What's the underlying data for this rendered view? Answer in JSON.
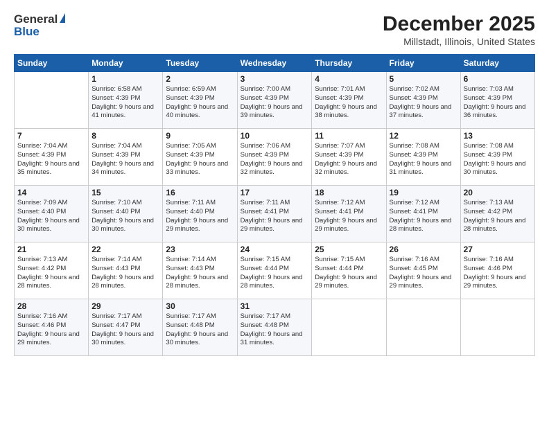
{
  "logo": {
    "line1": "General",
    "line2": "Blue"
  },
  "title": "December 2025",
  "subtitle": "Millstadt, Illinois, United States",
  "days_of_week": [
    "Sunday",
    "Monday",
    "Tuesday",
    "Wednesday",
    "Thursday",
    "Friday",
    "Saturday"
  ],
  "weeks": [
    [
      {
        "day": "",
        "sunrise": "",
        "sunset": "",
        "daylight": ""
      },
      {
        "day": "1",
        "sunrise": "Sunrise: 6:58 AM",
        "sunset": "Sunset: 4:39 PM",
        "daylight": "Daylight: 9 hours and 41 minutes."
      },
      {
        "day": "2",
        "sunrise": "Sunrise: 6:59 AM",
        "sunset": "Sunset: 4:39 PM",
        "daylight": "Daylight: 9 hours and 40 minutes."
      },
      {
        "day": "3",
        "sunrise": "Sunrise: 7:00 AM",
        "sunset": "Sunset: 4:39 PM",
        "daylight": "Daylight: 9 hours and 39 minutes."
      },
      {
        "day": "4",
        "sunrise": "Sunrise: 7:01 AM",
        "sunset": "Sunset: 4:39 PM",
        "daylight": "Daylight: 9 hours and 38 minutes."
      },
      {
        "day": "5",
        "sunrise": "Sunrise: 7:02 AM",
        "sunset": "Sunset: 4:39 PM",
        "daylight": "Daylight: 9 hours and 37 minutes."
      },
      {
        "day": "6",
        "sunrise": "Sunrise: 7:03 AM",
        "sunset": "Sunset: 4:39 PM",
        "daylight": "Daylight: 9 hours and 36 minutes."
      }
    ],
    [
      {
        "day": "7",
        "sunrise": "Sunrise: 7:04 AM",
        "sunset": "Sunset: 4:39 PM",
        "daylight": "Daylight: 9 hours and 35 minutes."
      },
      {
        "day": "8",
        "sunrise": "Sunrise: 7:04 AM",
        "sunset": "Sunset: 4:39 PM",
        "daylight": "Daylight: 9 hours and 34 minutes."
      },
      {
        "day": "9",
        "sunrise": "Sunrise: 7:05 AM",
        "sunset": "Sunset: 4:39 PM",
        "daylight": "Daylight: 9 hours and 33 minutes."
      },
      {
        "day": "10",
        "sunrise": "Sunrise: 7:06 AM",
        "sunset": "Sunset: 4:39 PM",
        "daylight": "Daylight: 9 hours and 32 minutes."
      },
      {
        "day": "11",
        "sunrise": "Sunrise: 7:07 AM",
        "sunset": "Sunset: 4:39 PM",
        "daylight": "Daylight: 9 hours and 32 minutes."
      },
      {
        "day": "12",
        "sunrise": "Sunrise: 7:08 AM",
        "sunset": "Sunset: 4:39 PM",
        "daylight": "Daylight: 9 hours and 31 minutes."
      },
      {
        "day": "13",
        "sunrise": "Sunrise: 7:08 AM",
        "sunset": "Sunset: 4:39 PM",
        "daylight": "Daylight: 9 hours and 30 minutes."
      }
    ],
    [
      {
        "day": "14",
        "sunrise": "Sunrise: 7:09 AM",
        "sunset": "Sunset: 4:40 PM",
        "daylight": "Daylight: 9 hours and 30 minutes."
      },
      {
        "day": "15",
        "sunrise": "Sunrise: 7:10 AM",
        "sunset": "Sunset: 4:40 PM",
        "daylight": "Daylight: 9 hours and 30 minutes."
      },
      {
        "day": "16",
        "sunrise": "Sunrise: 7:11 AM",
        "sunset": "Sunset: 4:40 PM",
        "daylight": "Daylight: 9 hours and 29 minutes."
      },
      {
        "day": "17",
        "sunrise": "Sunrise: 7:11 AM",
        "sunset": "Sunset: 4:41 PM",
        "daylight": "Daylight: 9 hours and 29 minutes."
      },
      {
        "day": "18",
        "sunrise": "Sunrise: 7:12 AM",
        "sunset": "Sunset: 4:41 PM",
        "daylight": "Daylight: 9 hours and 29 minutes."
      },
      {
        "day": "19",
        "sunrise": "Sunrise: 7:12 AM",
        "sunset": "Sunset: 4:41 PM",
        "daylight": "Daylight: 9 hours and 28 minutes."
      },
      {
        "day": "20",
        "sunrise": "Sunrise: 7:13 AM",
        "sunset": "Sunset: 4:42 PM",
        "daylight": "Daylight: 9 hours and 28 minutes."
      }
    ],
    [
      {
        "day": "21",
        "sunrise": "Sunrise: 7:13 AM",
        "sunset": "Sunset: 4:42 PM",
        "daylight": "Daylight: 9 hours and 28 minutes."
      },
      {
        "day": "22",
        "sunrise": "Sunrise: 7:14 AM",
        "sunset": "Sunset: 4:43 PM",
        "daylight": "Daylight: 9 hours and 28 minutes."
      },
      {
        "day": "23",
        "sunrise": "Sunrise: 7:14 AM",
        "sunset": "Sunset: 4:43 PM",
        "daylight": "Daylight: 9 hours and 28 minutes."
      },
      {
        "day": "24",
        "sunrise": "Sunrise: 7:15 AM",
        "sunset": "Sunset: 4:44 PM",
        "daylight": "Daylight: 9 hours and 28 minutes."
      },
      {
        "day": "25",
        "sunrise": "Sunrise: 7:15 AM",
        "sunset": "Sunset: 4:44 PM",
        "daylight": "Daylight: 9 hours and 29 minutes."
      },
      {
        "day": "26",
        "sunrise": "Sunrise: 7:16 AM",
        "sunset": "Sunset: 4:45 PM",
        "daylight": "Daylight: 9 hours and 29 minutes."
      },
      {
        "day": "27",
        "sunrise": "Sunrise: 7:16 AM",
        "sunset": "Sunset: 4:46 PM",
        "daylight": "Daylight: 9 hours and 29 minutes."
      }
    ],
    [
      {
        "day": "28",
        "sunrise": "Sunrise: 7:16 AM",
        "sunset": "Sunset: 4:46 PM",
        "daylight": "Daylight: 9 hours and 29 minutes."
      },
      {
        "day": "29",
        "sunrise": "Sunrise: 7:17 AM",
        "sunset": "Sunset: 4:47 PM",
        "daylight": "Daylight: 9 hours and 30 minutes."
      },
      {
        "day": "30",
        "sunrise": "Sunrise: 7:17 AM",
        "sunset": "Sunset: 4:48 PM",
        "daylight": "Daylight: 9 hours and 30 minutes."
      },
      {
        "day": "31",
        "sunrise": "Sunrise: 7:17 AM",
        "sunset": "Sunset: 4:48 PM",
        "daylight": "Daylight: 9 hours and 31 minutes."
      },
      {
        "day": "",
        "sunrise": "",
        "sunset": "",
        "daylight": ""
      },
      {
        "day": "",
        "sunrise": "",
        "sunset": "",
        "daylight": ""
      },
      {
        "day": "",
        "sunrise": "",
        "sunset": "",
        "daylight": ""
      }
    ]
  ]
}
